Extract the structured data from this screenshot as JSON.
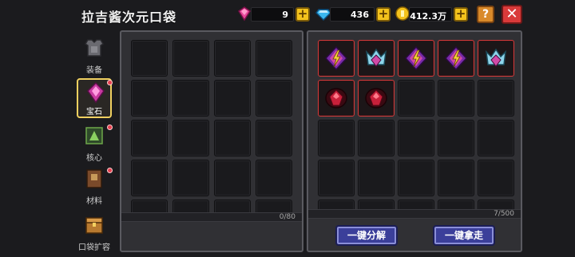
{
  "header": {
    "title": "拉吉酱次元口袋"
  },
  "resources": [
    {
      "name": "pink-gem",
      "value": "9",
      "color": "#e6469a"
    },
    {
      "name": "blue-diamond",
      "value": "436",
      "color": "#3ab8f0"
    },
    {
      "name": "gold-coin",
      "value": "412.3万",
      "color": "#f3c21c"
    }
  ],
  "header_buttons": {
    "help": "?",
    "close": "✕",
    "plus": "+"
  },
  "sidebar": {
    "items": [
      {
        "label": "装备",
        "icon": "armor-icon",
        "active": false,
        "badge": false
      },
      {
        "label": "宝石",
        "icon": "gem-icon",
        "active": true,
        "badge": true
      },
      {
        "label": "核心",
        "icon": "core-icon",
        "active": false,
        "badge": true
      },
      {
        "label": "材料",
        "icon": "book-icon",
        "active": false,
        "badge": true
      },
      {
        "label": "口袋扩容",
        "icon": "chest-icon",
        "active": false,
        "badge": false
      }
    ]
  },
  "left_panel": {
    "count": "0/80"
  },
  "right_panel": {
    "count": "7/500",
    "items": [
      "lightning-gem-icon",
      "crown-gem-icon",
      "lightning-gem-icon",
      "lightning-gem-icon",
      "crown-gem-icon",
      "ruby-icon",
      "ruby-icon"
    ],
    "buttons": {
      "dismantle": "一键分解",
      "take_all": "一键拿走"
    }
  }
}
